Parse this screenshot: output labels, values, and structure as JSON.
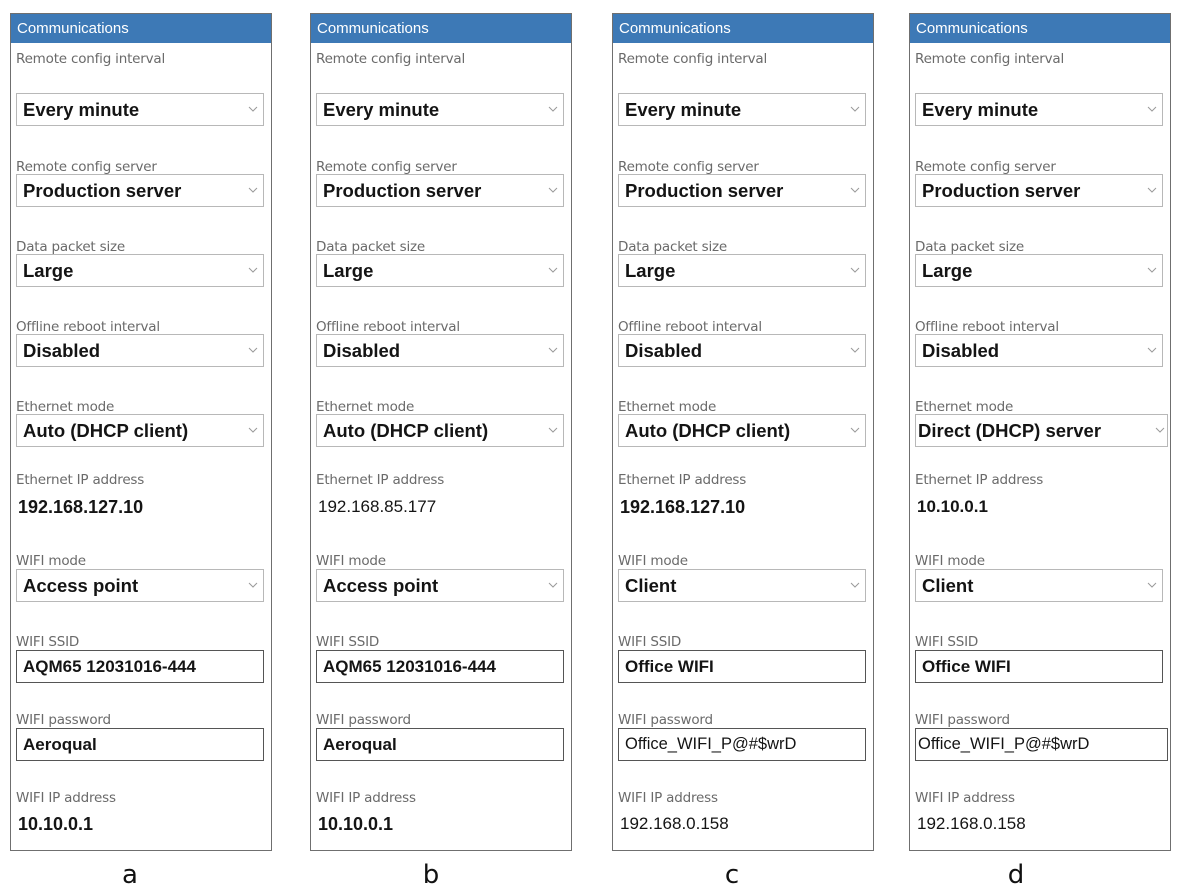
{
  "panels": [
    {
      "caption": "a",
      "header": "Communications",
      "remote_config_interval": {
        "label": "Remote config interval",
        "value": "Every minute"
      },
      "remote_config_server": {
        "label": "Remote config server",
        "value": "Production server"
      },
      "data_packet_size": {
        "label": "Data packet size",
        "value": "Large"
      },
      "offline_reboot_interval": {
        "label": "Offline reboot interval",
        "value": "Disabled"
      },
      "ethernet_mode": {
        "label": "Ethernet mode",
        "value": "Auto (DHCP client)"
      },
      "ethernet_ip": {
        "label": "Ethernet IP address",
        "value": "192.168.127.10"
      },
      "wifi_mode": {
        "label": "WIFI mode",
        "value": " Access  point"
      },
      "wifi_ssid": {
        "label": "WIFI SSID",
        "value": " AQM65 12031016-444"
      },
      "wifi_password": {
        "label": "WIFI password",
        "value": "Aeroqual"
      },
      "wifi_ip": {
        "label": "WIFI IP address",
        "value": "10.10.0.1"
      }
    },
    {
      "caption": "b",
      "header": "Communications",
      "remote_config_interval": {
        "label": "Remote config interval",
        "value": "Every minute"
      },
      "remote_config_server": {
        "label": "Remote config server",
        "value": "Production server"
      },
      "data_packet_size": {
        "label": "Data packet size",
        "value": "Large"
      },
      "offline_reboot_interval": {
        "label": "Offline reboot interval",
        "value": "Disabled"
      },
      "ethernet_mode": {
        "label": "Ethernet mode",
        "value": "Auto (DHCP client)"
      },
      "ethernet_ip": {
        "label": "Ethernet IP address",
        "value": " 192.168.85.177"
      },
      "wifi_mode": {
        "label": "WIFI mode",
        "value": " Access  point"
      },
      "wifi_ssid": {
        "label": "WIFI SSID",
        "value": " AQM65 12031016-444"
      },
      "wifi_password": {
        "label": "WIFI password",
        "value": "Aeroqual"
      },
      "wifi_ip": {
        "label": "WIFI IP address",
        "value": "10.10.0.1"
      }
    },
    {
      "caption": "c",
      "header": "Communications",
      "remote_config_interval": {
        "label": "Remote config interval",
        "value": "Every minute"
      },
      "remote_config_server": {
        "label": "Remote config server",
        "value": "Production server"
      },
      "data_packet_size": {
        "label": "Data packet size",
        "value": "Large"
      },
      "offline_reboot_interval": {
        "label": "Offline reboot interval",
        "value": "Disabled"
      },
      "ethernet_mode": {
        "label": "Ethernet mode",
        "value": "Auto (DHCP client)"
      },
      "ethernet_ip": {
        "label": "Ethernet IP address",
        "value": "192.168.127.10"
      },
      "wifi_mode": {
        "label": "WIFI mode",
        "value": " Client"
      },
      "wifi_ssid": {
        "label": "WIFI SSID",
        "value": " Office WIFI"
      },
      "wifi_password": {
        "label": "WIFI password",
        "value": " Office_WIFI_P@#$wrD"
      },
      "wifi_ip": {
        "label": "WIFI IP address",
        "value": " 192.168.0.158"
      }
    },
    {
      "caption": "d",
      "header": "Communications",
      "remote_config_interval": {
        "label": "Remote config interval",
        "value": "Every minute"
      },
      "remote_config_server": {
        "label": "Remote config server",
        "value": "Production server"
      },
      "data_packet_size": {
        "label": "Data packet size",
        "value": "Large"
      },
      "offline_reboot_interval": {
        "label": "Offline reboot interval",
        "value": "Disabled"
      },
      "ethernet_mode": {
        "label": "Ethernet mode",
        "value": " Direct (DHCP)  server"
      },
      "ethernet_ip": {
        "label": "Ethernet IP address",
        "value": " 10.10.0.1"
      },
      "wifi_mode": {
        "label": "WIFI mode",
        "value": " Client"
      },
      "wifi_ssid": {
        "label": "WIFI SSID",
        "value": " Office WIFI"
      },
      "wifi_password": {
        "label": "WIFI password",
        "value": " Office_WIFI_P@#$wrD"
      },
      "wifi_ip": {
        "label": "WIFI IP address",
        "value": " 192.168.0.158"
      }
    }
  ],
  "icons": {
    "dropdown": "chevron-down-icon"
  },
  "colors": {
    "header_bg": "#3d79b6",
    "header_text": "#ffffff",
    "label_text": "#6a6a6a",
    "value_text": "#141414"
  }
}
